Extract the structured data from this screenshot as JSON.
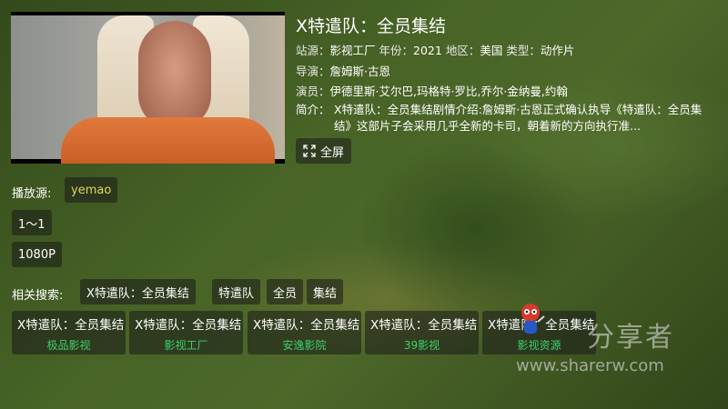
{
  "detail": {
    "title": "X特遣队：全员集结",
    "source_label": "站源：",
    "source_value": "影视工厂",
    "year_label": "年份：",
    "year_value": "2021",
    "region_label": "地区：",
    "region_value": "美国",
    "type_label": "类型：",
    "type_value": "动作片",
    "director_label": "导演：",
    "director_value": "詹姆斯·古恩",
    "cast_label": "演员：",
    "cast_value": "伊德里斯·艾尔巴,玛格特·罗比,乔尔·金纳曼,约翰",
    "intro_label": "简介：",
    "intro_value": "X特遣队：全员集结剧情介绍:詹姆斯·古恩正式确认执导《特遣队：全员集结》这部片子会采用几乎全新的卡司，朝着新的方向执行准...",
    "fullscreen_label": "全屏"
  },
  "playback": {
    "source_label": "播放源:",
    "source_selected": "yemao",
    "episode": "1～1",
    "quality": "1080P"
  },
  "related": {
    "label": "相关搜索:",
    "tags": [
      "X特遣队：全员集结",
      "特遣队",
      "全员",
      "集结"
    ]
  },
  "results": [
    {
      "title": "X特遣队：全员集结",
      "site": "极品影视"
    },
    {
      "title": "X特遣队：全员集结",
      "site": "影视工厂"
    },
    {
      "title": "X特遣队：全员集结",
      "site": "安逸影院"
    },
    {
      "title": "X特遣队：全员集结",
      "site": "39影视"
    },
    {
      "title": "X特遣队：全员集结",
      "site": "影视资源"
    }
  ],
  "watermark": {
    "title": "分享者",
    "url": "www.sharerw.com"
  },
  "colors": {
    "accent_yellow": "#e6d45a",
    "site_green": "#3fd06a",
    "chip_bg": "rgba(25,25,25,0.55)"
  }
}
